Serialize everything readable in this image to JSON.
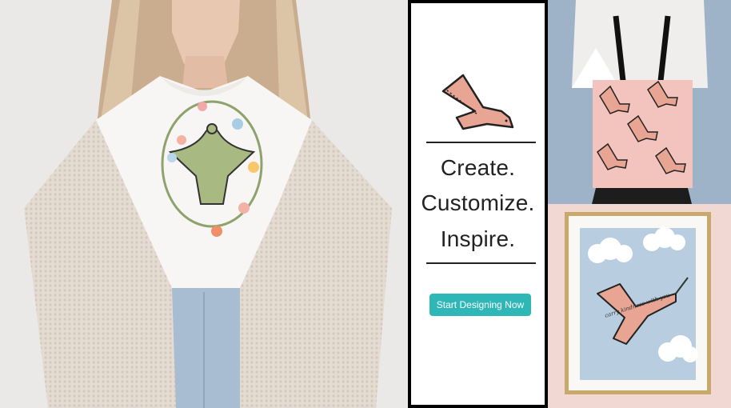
{
  "promo": {
    "taglines": [
      "Create.",
      "Customize.",
      "Inspire."
    ],
    "cta_label": "Start Designing Now"
  },
  "print": {
    "caption": "carry kindness with you"
  },
  "colors": {
    "accent": "#2fb7b8",
    "bird_pink": "#e9a593",
    "shirt_bird_green": "#a9b982",
    "tote_pink": "#f3c3bd",
    "print_sky": "#b8cde0"
  },
  "icons": [
    "dove-logo-icon",
    "flower-icon",
    "cloud-icon",
    "olive-branch-icon"
  ]
}
